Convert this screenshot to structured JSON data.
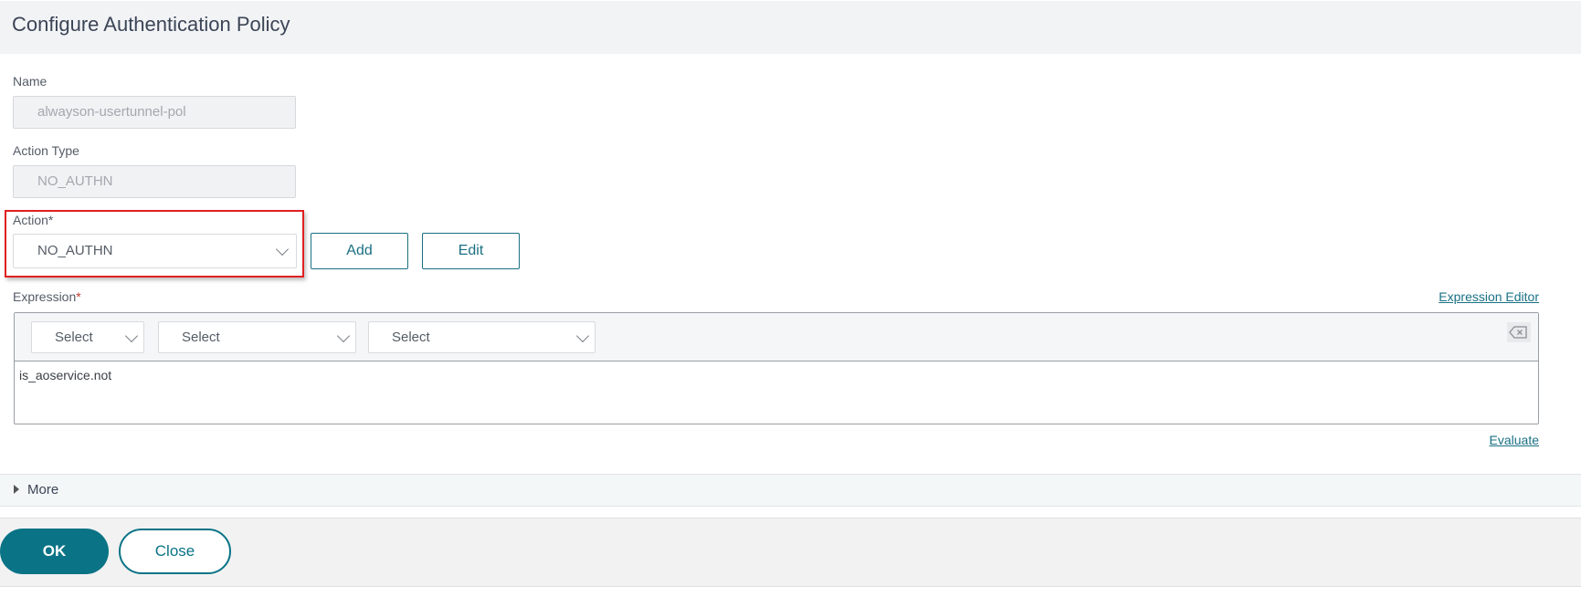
{
  "header": {
    "title": "Configure Authentication Policy"
  },
  "form": {
    "name": {
      "label": "Name",
      "value": "alwayson-usertunnel-pol"
    },
    "action_type": {
      "label": "Action Type",
      "value": "NO_AUTHN"
    },
    "action": {
      "label": "Action",
      "required_mark": "*",
      "value": "NO_AUTHN",
      "add_label": "Add",
      "edit_label": "Edit"
    },
    "expression": {
      "label": "Expression",
      "required_mark": "*",
      "editor_link": "Expression Editor",
      "selects": [
        "Select",
        "Select",
        "Select"
      ],
      "value": "is_aoservice.not",
      "evaluate_link": "Evaluate"
    }
  },
  "more": {
    "label": "More"
  },
  "footer": {
    "ok_label": "OK",
    "close_label": "Close"
  },
  "colors": {
    "accent": "#0a7386",
    "highlight": "#e02020"
  }
}
